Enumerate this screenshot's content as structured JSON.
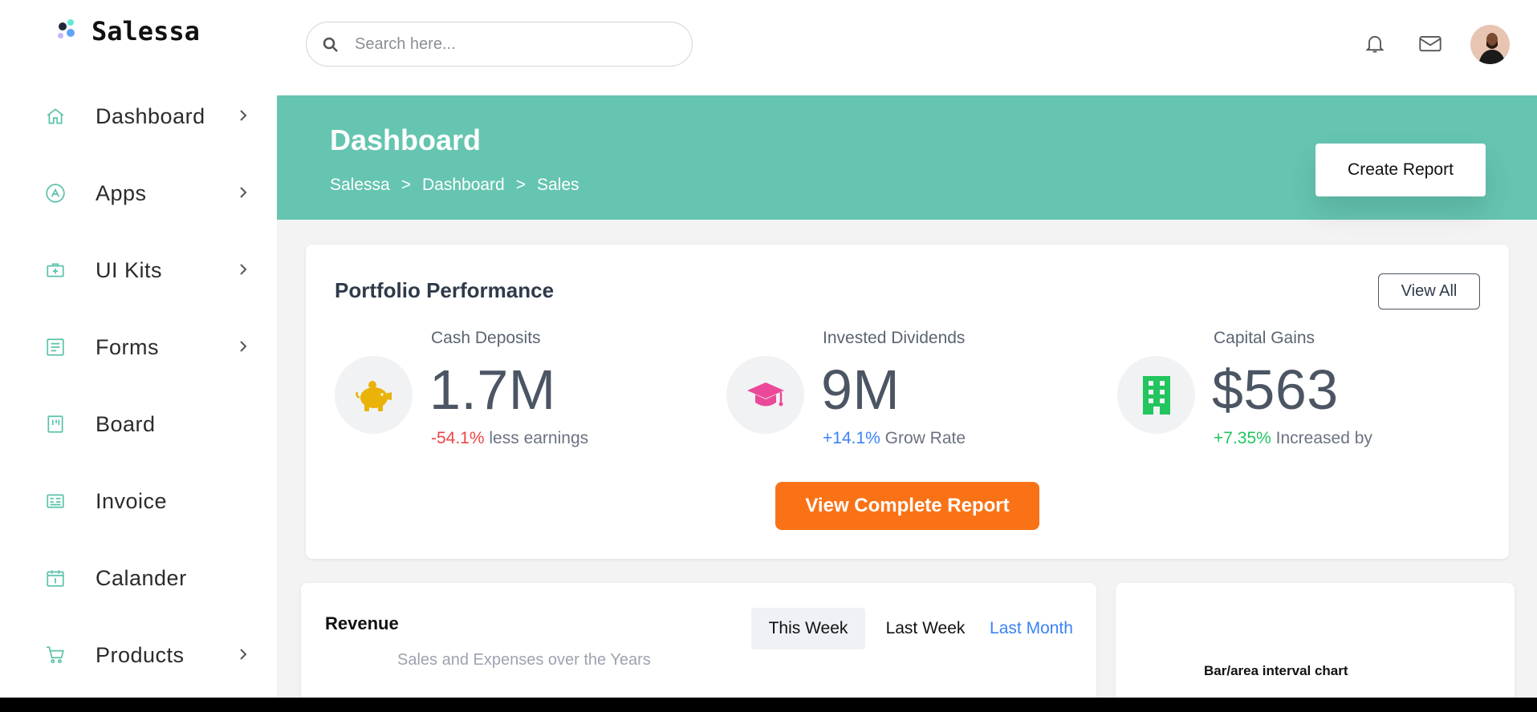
{
  "brand": {
    "name": "Salessa"
  },
  "sidebar": {
    "items": [
      {
        "label": "Dashboard",
        "icon": "home-icon",
        "has_submenu": true
      },
      {
        "label": "Apps",
        "icon": "app-store-icon",
        "has_submenu": true
      },
      {
        "label": "UI Kits",
        "icon": "kit-icon",
        "has_submenu": true
      },
      {
        "label": "Forms",
        "icon": "form-icon",
        "has_submenu": true
      },
      {
        "label": "Board",
        "icon": "board-icon",
        "has_submenu": false
      },
      {
        "label": "Invoice",
        "icon": "invoice-icon",
        "has_submenu": false
      },
      {
        "label": "Calander",
        "icon": "calendar-icon",
        "has_submenu": false
      },
      {
        "label": "Products",
        "icon": "cart-icon",
        "has_submenu": true
      }
    ]
  },
  "search": {
    "placeholder": "Search here...",
    "value": ""
  },
  "header": {
    "title": "Dashboard",
    "breadcrumb": [
      "Salessa",
      "Dashboard",
      "Sales"
    ],
    "breadcrumb_separator": ">",
    "create_report_label": "Create Report"
  },
  "portfolio": {
    "title": "Portfolio Performance",
    "view_all_label": "View All",
    "metrics": [
      {
        "label": "Cash Deposits",
        "value": "1.7M",
        "change": "-54.1%",
        "change_color": "#ef4444",
        "change_text": "less earnings",
        "icon": "piggy-bank-icon",
        "icon_color": "#eab308"
      },
      {
        "label": "Invested Dividends",
        "value": "9M",
        "change": "+14.1%",
        "change_color": "#3b82f6",
        "change_text": "Grow Rate",
        "icon": "graduation-cap-icon",
        "icon_color": "#ec4899"
      },
      {
        "label": "Capital Gains",
        "value": "$563",
        "change": "+7.35%",
        "change_color": "#22c55e",
        "change_text": "Increased by",
        "icon": "building-icon",
        "icon_color": "#22c55e"
      }
    ],
    "report_button_label": "View Complete Report"
  },
  "revenue": {
    "title": "Revenue",
    "subtitle": "Sales and Expenses over the Years",
    "tabs": [
      {
        "label": "This Week",
        "active": true
      },
      {
        "label": "Last Week",
        "active": false
      },
      {
        "label": "Last Month",
        "active": false
      }
    ]
  },
  "side_chart": {
    "caption": "Bar/area interval chart"
  },
  "colors": {
    "accent": "#65c5b0",
    "primary_button": "#f97316",
    "link": "#3b82f6"
  }
}
